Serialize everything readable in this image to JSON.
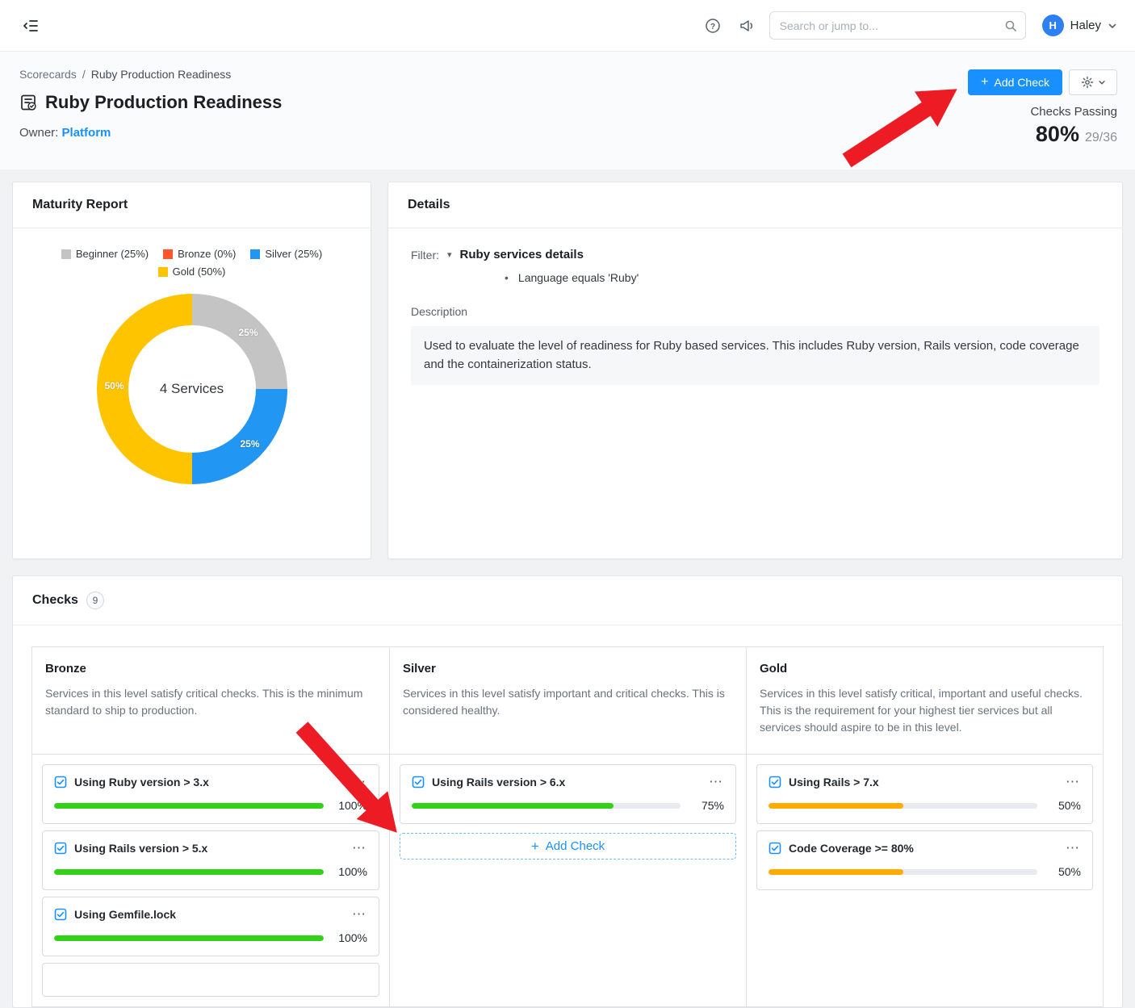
{
  "colors": {
    "accent": "#1890ff",
    "green": "#33d117",
    "orange": "#ffab00",
    "arrow_red": "#ed1c24"
  },
  "icons": {
    "ellipsis": "⋯",
    "bullet": "•",
    "caret_down": "▾",
    "plus": "+"
  },
  "topbar": {
    "search_placeholder": "Search or jump to...",
    "avatar_initial": "H",
    "user_name": "Haley"
  },
  "header": {
    "breadcrumb": [
      "Scorecards",
      "Ruby Production Readiness"
    ],
    "breadcrumb_separator": "/",
    "title": "Ruby Production Readiness",
    "owner_label": "Owner:",
    "owner_value": "Platform",
    "add_check_label": "Add Check",
    "checks_passing_label": "Checks Passing",
    "checks_passing_pct": "80%",
    "checks_passing_count": "29/36"
  },
  "maturity": {
    "title": "Maturity Report",
    "center_label": "4 Services",
    "segment_labels": [
      "25%",
      "25%",
      "50%"
    ],
    "legend": [
      {
        "label": "Beginner (25%)",
        "color": "#c4c4c4"
      },
      {
        "label": "Bronze (0%)",
        "color": "#ff5630"
      },
      {
        "label": "Silver (25%)",
        "color": "#2196f3"
      },
      {
        "label": "Gold (50%)",
        "color": "#ffc400"
      }
    ],
    "chart_data": {
      "type": "pie",
      "title": "Maturity Report",
      "categories": [
        "Beginner",
        "Bronze",
        "Silver",
        "Gold"
      ],
      "values": [
        25,
        0,
        25,
        50
      ],
      "center_label": "4 Services",
      "legend_position": "top"
    }
  },
  "details": {
    "title": "Details",
    "filter_label": "Filter:",
    "filter_name": "Ruby services details",
    "filter_rule": "Language equals 'Ruby'",
    "description_label": "Description",
    "description_text": "Used to evaluate the level of readiness for Ruby based services. This includes Ruby version, Rails version, code coverage and the containerization status."
  },
  "checks": {
    "title": "Checks",
    "count": "9",
    "add_check_label": "Add Check",
    "columns": [
      {
        "name": "Bronze",
        "description": "Services in this level satisfy critical checks. This is the minimum standard to ship to production.",
        "has_add_button": false,
        "partial_card": true,
        "items": [
          {
            "label": "Using Ruby version > 3.x",
            "pct": 100,
            "pct_label": "100%",
            "color": "#33d117"
          },
          {
            "label": "Using Rails version > 5.x",
            "pct": 100,
            "pct_label": "100%",
            "color": "#33d117"
          },
          {
            "label": "Using Gemfile.lock",
            "pct": 100,
            "pct_label": "100%",
            "color": "#33d117"
          }
        ]
      },
      {
        "name": "Silver",
        "description": "Services in this level satisfy important and critical checks. This is considered healthy.",
        "has_add_button": true,
        "partial_card": false,
        "items": [
          {
            "label": "Using Rails version > 6.x",
            "pct": 75,
            "pct_label": "75%",
            "color": "#33d117"
          }
        ]
      },
      {
        "name": "Gold",
        "description": "Services in this level satisfy critical, important and useful checks. This is the requirement for your highest tier services but all services should aspire to be in this level.",
        "has_add_button": false,
        "partial_card": false,
        "items": [
          {
            "label": "Using Rails > 7.x",
            "pct": 50,
            "pct_label": "50%",
            "color": "#ffab00"
          },
          {
            "label": "Code Coverage >= 80%",
            "pct": 50,
            "pct_label": "50%",
            "color": "#ffab00"
          }
        ]
      }
    ]
  }
}
